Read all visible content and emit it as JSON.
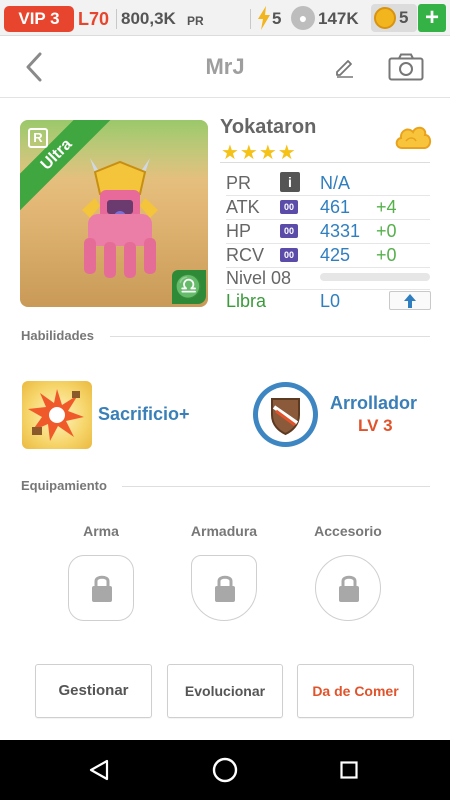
{
  "status": {
    "vip": "VIP 3",
    "level": "L70",
    "pr_value": "800,3K",
    "pr_label": "PR",
    "energy": "5",
    "paws": "147K",
    "gems": "5",
    "plus": "+"
  },
  "header": {
    "title": "MrJ"
  },
  "monster": {
    "rarity_tag": "R",
    "rarity": "Ultra",
    "name": "Yokataron",
    "stars": "★★★★",
    "zodiac_symbol": "♎",
    "stats": {
      "pr": {
        "label": "PR",
        "info": "i",
        "value": "N/A"
      },
      "atk": {
        "label": "ATK",
        "tag": "00",
        "value": "461",
        "bonus": "+4"
      },
      "hp": {
        "label": "HP",
        "tag": "00",
        "value": "4331",
        "bonus": "+0"
      },
      "rcv": {
        "label": "RCV",
        "tag": "00",
        "value": "425",
        "bonus": "+0"
      },
      "level": {
        "label": "Nivel 08",
        "progress": 0
      },
      "sign": {
        "label": "Libra",
        "value": "L0"
      }
    }
  },
  "abilities": {
    "title": "Habilidades",
    "skill1": {
      "name": "Sacrificio+"
    },
    "skill2": {
      "name": "Arrollador",
      "level": "LV 3"
    }
  },
  "equipment": {
    "title": "Equipamiento",
    "slots": [
      "Arma",
      "Armadura",
      "Accesorio"
    ]
  },
  "buttons": {
    "manage": "Gestionar",
    "evolve": "Evolucionar",
    "feed": "Da de Comer"
  },
  "colors": {
    "vip_red": "#e8452e",
    "link_blue": "#2f7fc0",
    "bonus_green": "#55b04a",
    "feed_orange": "#e0532b",
    "plus_green": "#34b245"
  }
}
